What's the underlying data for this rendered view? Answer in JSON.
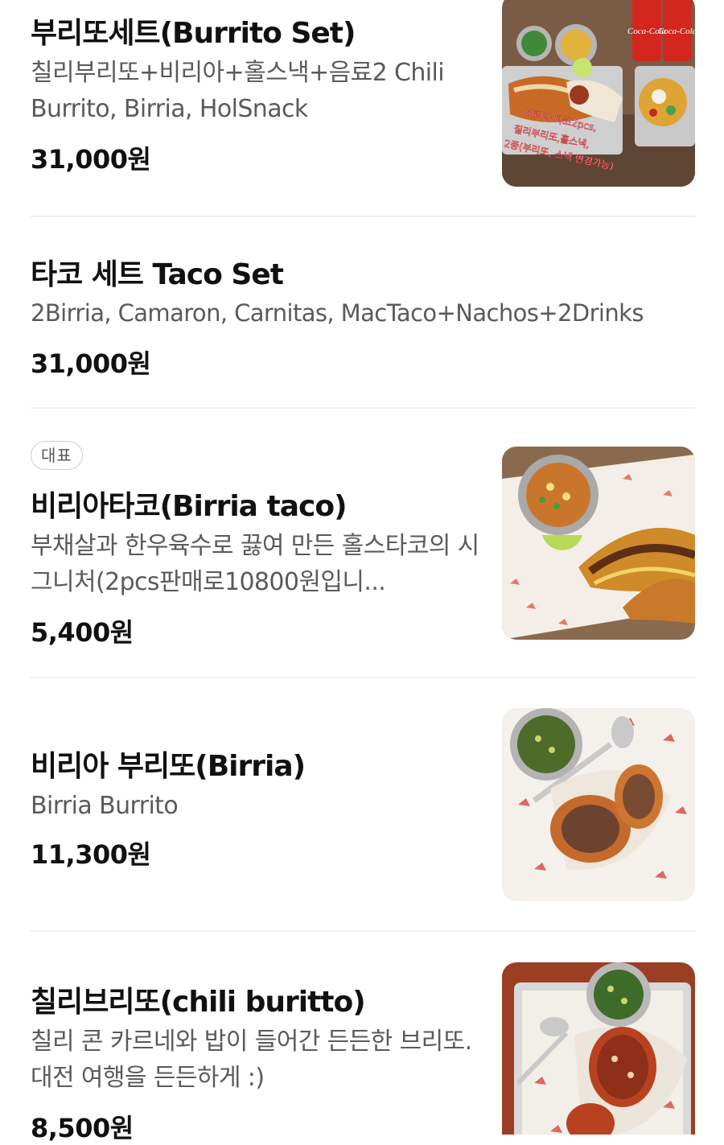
{
  "menu": {
    "items": [
      {
        "name": "부리또세트(Burrito Set)",
        "description": "칠리부리또+비리아+홀스낵+음료2 Chili Burrito, Birria, HolSnack",
        "price": "31,000원",
        "badge": null,
        "image": {
          "overlay_lines": [
            "비리아 타코2pcs,",
            "칠리부리또,홀스낵,",
            "2종(부리또, 스낵 변경가능)"
          ],
          "can_label": "Coca-Cola"
        }
      },
      {
        "name": "타코 세트 Taco Set",
        "description": "2Birria, Camaron, Carnitas, MacTaco+Nachos+2Drinks",
        "price": "31,000원",
        "badge": null,
        "image": null
      },
      {
        "name": "비리아타코(Birria taco)",
        "description": "부채살과 한우육수로 끓여 만든 홀스타코의 시그니처(2pcs판매로10800원입니...",
        "price": "5,400원",
        "badge": "대표",
        "image": {}
      },
      {
        "name": "비리아 부리또(Birria)",
        "description": "Birria Burrito",
        "price": "11,300원",
        "badge": null,
        "image": {}
      },
      {
        "name": "칠리브리또(chili buritto)",
        "description": "칠리 콘 카르네와 밥이 들어간 든든한 브리또. 대전 여행을 든든하게 :)",
        "price": "8,500원",
        "badge": null,
        "image": {}
      }
    ]
  }
}
